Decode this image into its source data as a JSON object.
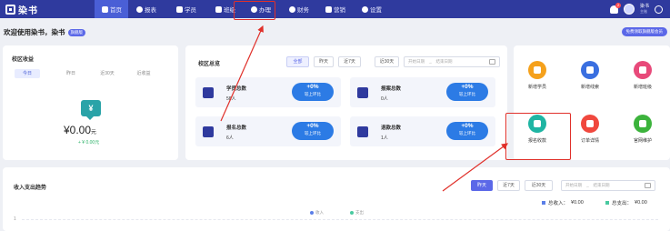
{
  "app": {
    "logo_text": "染书"
  },
  "nav": {
    "items": [
      {
        "label": "首页",
        "icon": "home-icon",
        "active": true
      },
      {
        "label": "报表",
        "icon": "chart-icon"
      },
      {
        "label": "学员",
        "icon": "student-icon"
      },
      {
        "label": "班级",
        "icon": "class-icon"
      },
      {
        "label": "办理",
        "icon": "handle-icon"
      },
      {
        "label": "财务",
        "icon": "finance-icon"
      },
      {
        "label": "营销",
        "icon": "marketing-icon"
      },
      {
        "label": "设置",
        "icon": "settings-icon"
      }
    ],
    "notification_count": "2",
    "user_name": "染书",
    "user_role": "主账"
  },
  "welcome": {
    "text": "欢迎使用染书，染书",
    "tag": "旗舰版",
    "free_button": "免费领取旗舰版会员"
  },
  "income_card": {
    "title": "校区收益",
    "tabs": [
      "今日",
      "昨日",
      "近30天",
      "近收益"
    ],
    "amount": "¥0.00",
    "unit": "元",
    "delta": "+ ¥ 0.00元"
  },
  "overview_card": {
    "title": "校区总览",
    "filters": [
      "全部",
      "昨天",
      "近7天",
      "近30天"
    ],
    "start_placeholder": "开始日期",
    "end_placeholder": "结束日期",
    "stats": [
      {
        "name": "学员总数",
        "value": "58人",
        "pct": "+0%",
        "compare": "较上环比"
      },
      {
        "name": "报案总数",
        "value": "0人",
        "pct": "+0%",
        "compare": "较上环比"
      },
      {
        "name": "报名总数",
        "value": "6人",
        "pct": "+0%",
        "compare": "较上环比"
      },
      {
        "name": "退款总数",
        "value": "1人",
        "pct": "+0%",
        "compare": "较上环比"
      }
    ]
  },
  "quick_actions": [
    {
      "label": "新增学员",
      "color": "#f5a11c",
      "icon": "graduation-cap-icon"
    },
    {
      "label": "新增线索",
      "color": "#3a6fe0",
      "icon": "link-icon"
    },
    {
      "label": "新增班级",
      "color": "#e84a7a",
      "icon": "class-board-icon"
    },
    {
      "label": "报名收款",
      "color": "#1fb5a3",
      "icon": "payment-icon"
    },
    {
      "label": "订单详情",
      "color": "#f0483e",
      "icon": "lightning-icon"
    },
    {
      "label": "官网维护",
      "color": "#3cb33c",
      "icon": "tools-icon"
    }
  ],
  "trend_card": {
    "title": "收入支出趋势",
    "filters": [
      "昨天",
      "近7天",
      "近30天"
    ],
    "start_placeholder": "开始日期",
    "end_placeholder": "结束日期",
    "income_label": "总收入：",
    "income_value": "¥0.00",
    "expense_label": "总支出：",
    "expense_value": "¥0.00",
    "legend_income": "收入",
    "legend_expense": "支出",
    "y_tick": "1"
  },
  "colors": {
    "nav": "#2f3a9e",
    "accent": "#5b68e8",
    "compare": "#2c7be5",
    "highlight": "#e0302a"
  }
}
